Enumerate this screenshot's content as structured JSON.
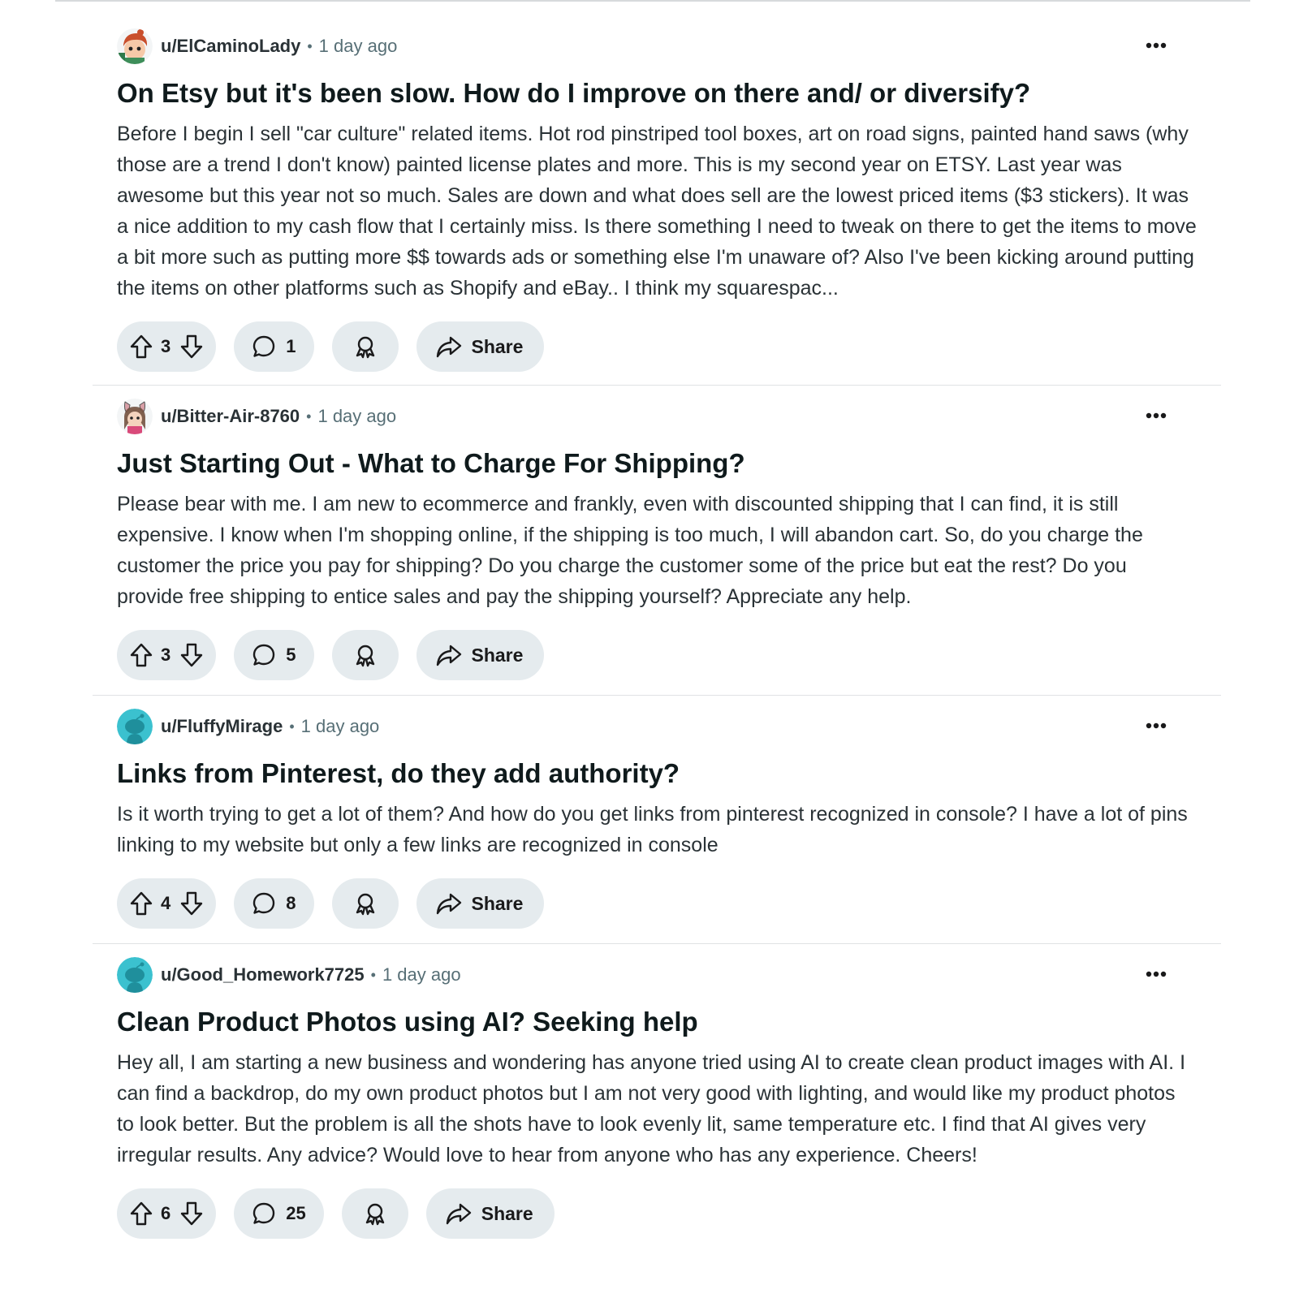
{
  "posts": [
    {
      "username": "u/ElCaminoLady",
      "separator": "•",
      "time": "1 day ago",
      "title": "On Etsy but it's been slow. How do I improve on there and/ or diversify?",
      "body": "Before I begin I sell \"car culture\" related items. Hot rod pinstriped tool boxes, art on road signs, painted hand saws (why those are a trend I don't know) painted license plates and more. This is my second year on ETSY. Last year was awesome but this year not so much. Sales are down and what does sell are the lowest priced items ($3 stickers). It was a nice addition to my cash flow that I certainly miss. Is there something I need to tweak on there to get the items to move a bit more such as putting more $$ towards ads or something else I'm unaware of? Also I've been kicking around putting the items on other platforms such as Shopify and eBay.. I think my squarespac...",
      "votes": "3",
      "comments": "1",
      "share_label": "Share",
      "avatar": "snoo-avatar-redhead"
    },
    {
      "username": "u/Bitter-Air-8760",
      "separator": "•",
      "time": "1 day ago",
      "title": "Just Starting Out - What to Charge For Shipping?",
      "body": "Please bear with me. I am new to ecommerce and frankly, even with discounted shipping that I can find, it is still expensive. I know when I'm shopping online, if the shipping is too much, I will abandon cart. So, do you charge the customer the price you pay for shipping? Do you charge the customer some of the price but eat the rest? Do you provide free shipping to entice sales and pay the shipping yourself? Appreciate any help.",
      "votes": "3",
      "comments": "5",
      "share_label": "Share",
      "avatar": "snoo-avatar-bunny-ears"
    },
    {
      "username": "u/FluffyMirage",
      "separator": "•",
      "time": "1 day ago",
      "title": "Links from Pinterest, do they add authority?",
      "body": "Is it worth trying to get a lot of them? And how do you get links from pinterest recognized in console? I have a lot of pins linking to my website but only a few links are recognized in console",
      "votes": "4",
      "comments": "8",
      "share_label": "Share",
      "avatar": "default-teal-snoo"
    },
    {
      "username": "u/Good_Homework7725",
      "separator": "•",
      "time": "1 day ago",
      "title": "Clean Product Photos using AI? Seeking help",
      "body": "Hey all, I am starting a new business and wondering has anyone tried using AI to create clean product images with AI. I can find a backdrop, do my own product photos but I am not very good with lighting, and would like my product photos to look better. But the problem is all the shots have to look evenly lit, same temperature etc. I find that AI gives very irregular results. Any advice? Would love to hear from anyone who has any experience. Cheers!",
      "votes": "6",
      "comments": "25",
      "share_label": "Share",
      "avatar": "default-teal-snoo"
    }
  ],
  "colors": {
    "pill_bg": "#e5ebee",
    "meta_gray": "#576f76",
    "teal_avatar": "#3bc1cf",
    "separator": "#e0e2e4"
  }
}
